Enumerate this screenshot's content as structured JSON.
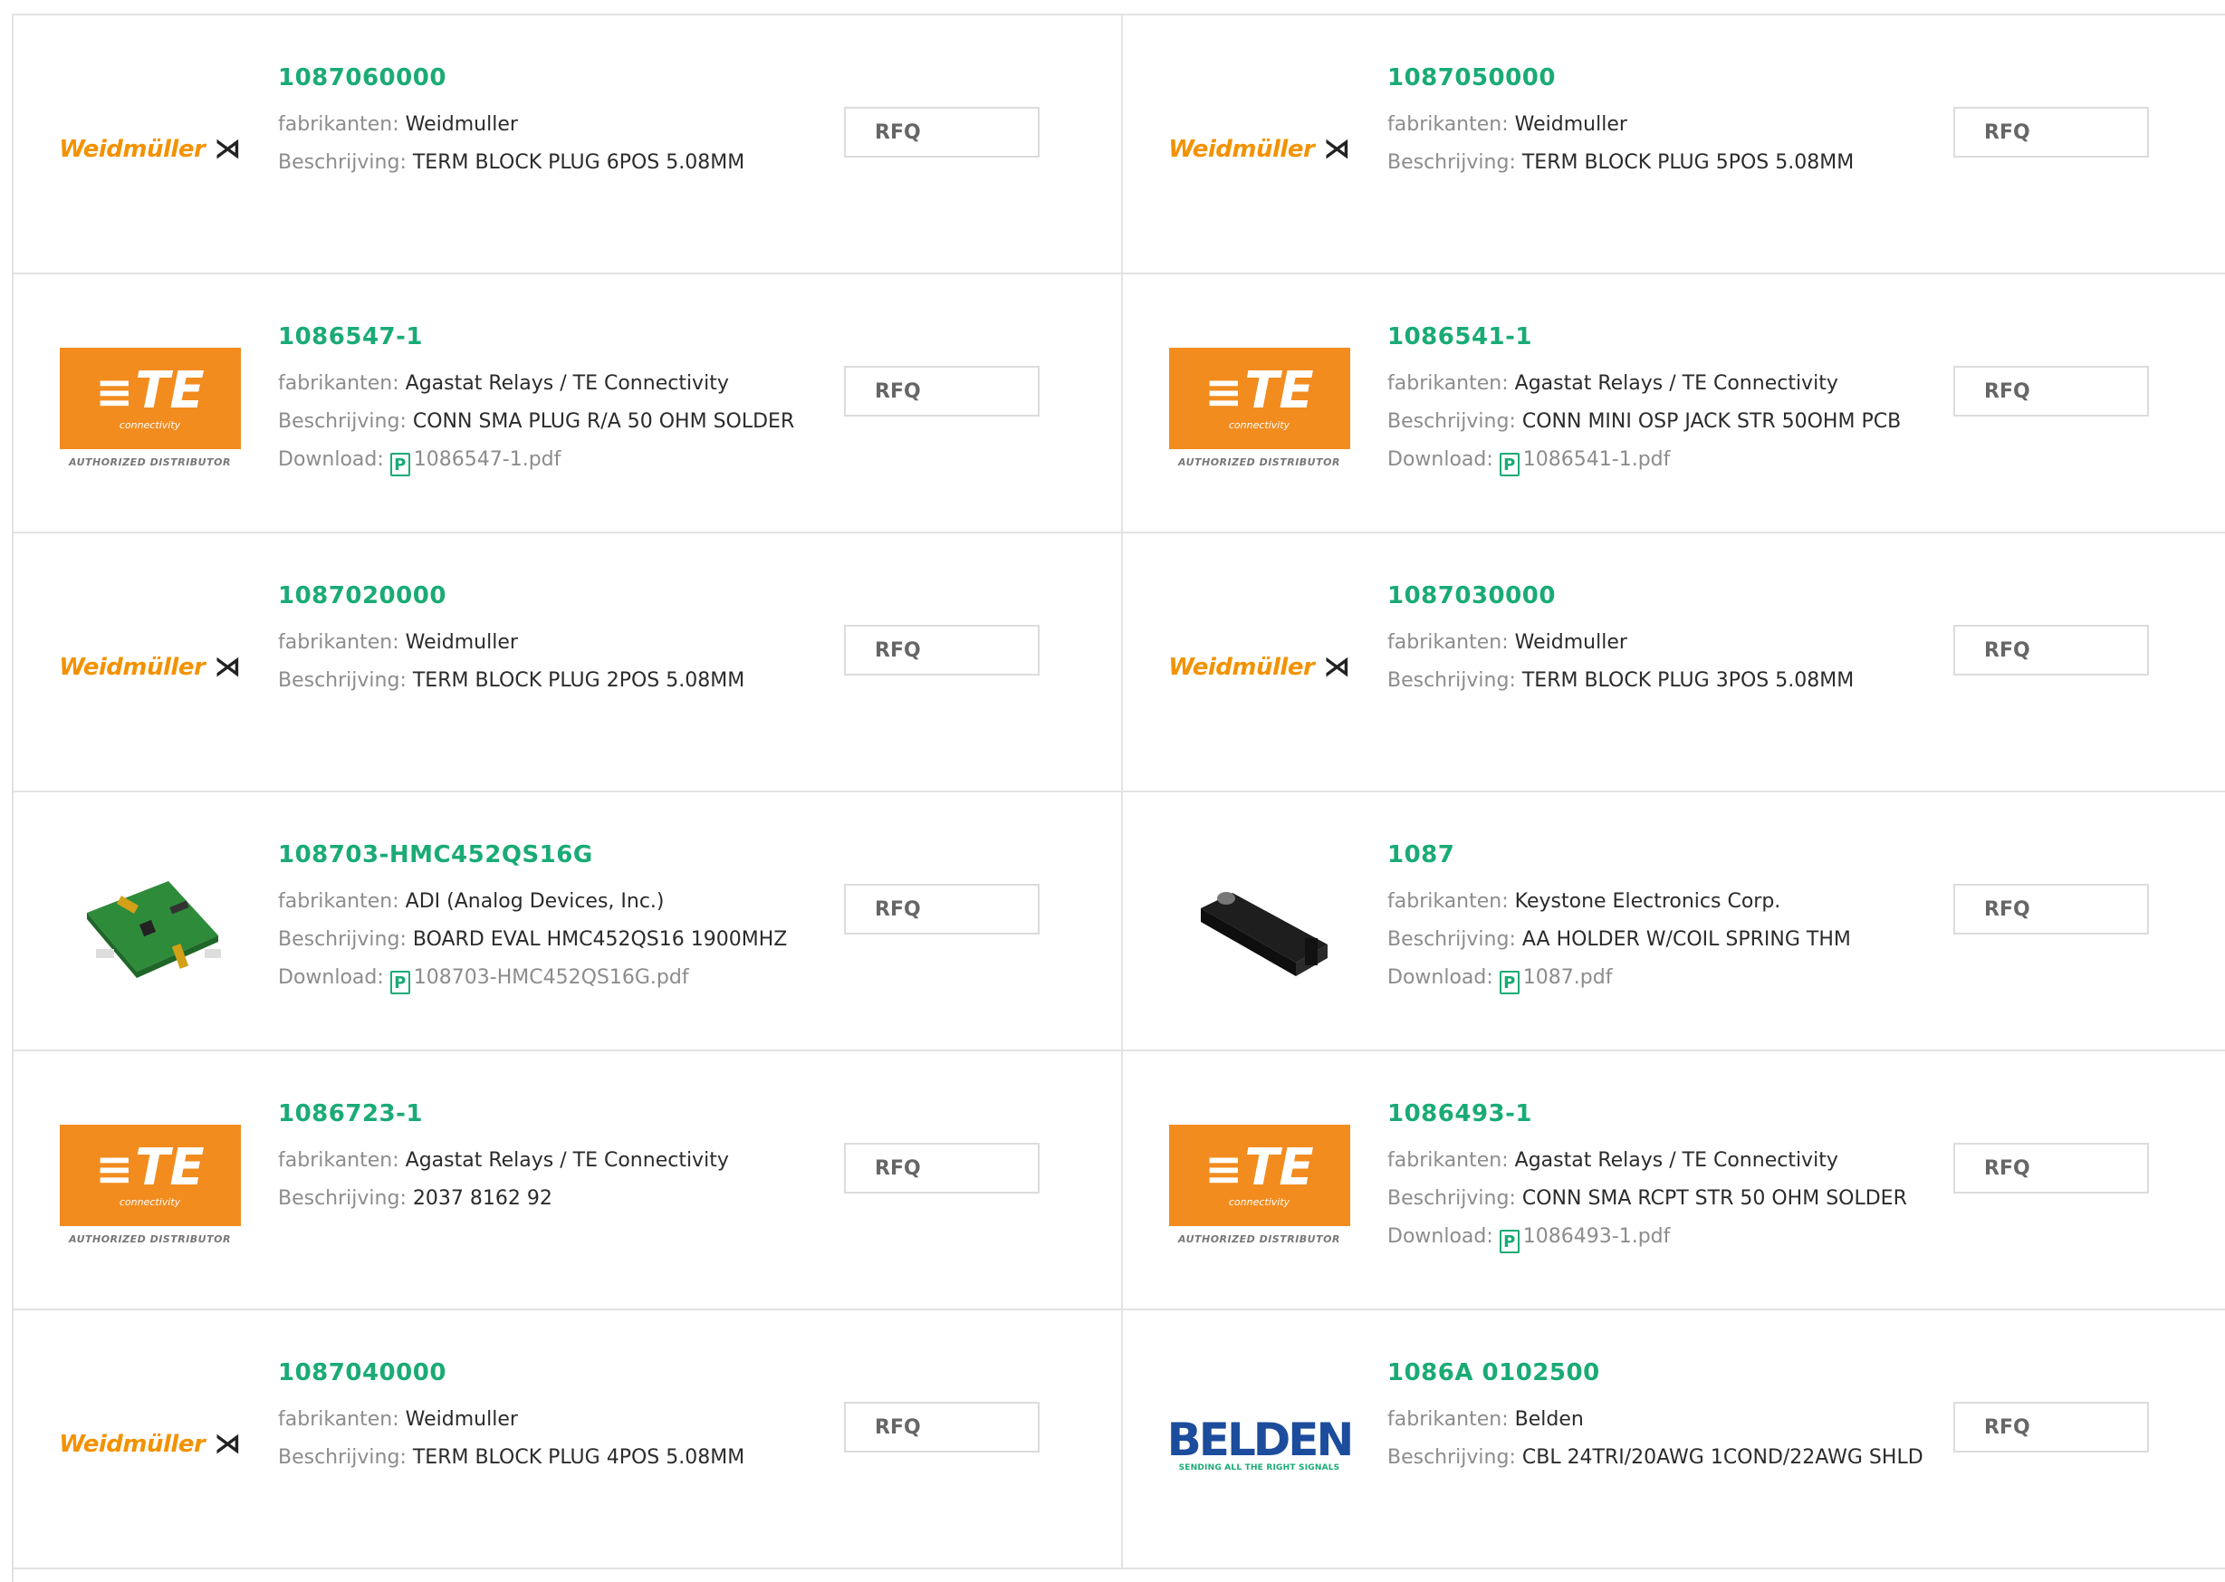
{
  "labels": {
    "manufacturer": "fabrikanten:",
    "description": "Beschrijving:",
    "download": "Download:",
    "rfq": "RFQ"
  },
  "colors": {
    "accent": "#1aab75",
    "weidmuller": "#f39200",
    "te_orange": "#f28c1f",
    "belden_blue": "#1c4c9c"
  },
  "logos": {
    "weidmuller": {
      "text": "Weidmüller",
      "icon": "weidmuller-mark-icon"
    },
    "te": {
      "text": "TE",
      "sub": "connectivity",
      "auth": "AUTHORIZED DISTRIBUTOR"
    },
    "belden": {
      "text": "BELDEN",
      "sub": "SENDING ALL THE RIGHT SIGNALS"
    }
  },
  "products": [
    {
      "pn": "1087060000",
      "manufacturer": "Weidmuller",
      "description": "TERM BLOCK PLUG 6POS 5.08MM",
      "pdf": null,
      "logo": "weidmuller"
    },
    {
      "pn": "1087050000",
      "manufacturer": "Weidmuller",
      "description": "TERM BLOCK PLUG 5POS 5.08MM",
      "pdf": null,
      "logo": "weidmuller"
    },
    {
      "pn": "1086547-1",
      "manufacturer": "Agastat Relays / TE Connectivity",
      "description": "CONN SMA PLUG R/A 50 OHM SOLDER",
      "pdf": "1086547-1.pdf",
      "logo": "te"
    },
    {
      "pn": "1086541-1",
      "manufacturer": "Agastat Relays / TE Connectivity",
      "description": "CONN MINI OSP JACK STR 50OHM PCB",
      "pdf": "1086541-1.pdf",
      "logo": "te"
    },
    {
      "pn": "1087020000",
      "manufacturer": "Weidmuller",
      "description": "TERM BLOCK PLUG 2POS 5.08MM",
      "pdf": null,
      "logo": "weidmuller"
    },
    {
      "pn": "1087030000",
      "manufacturer": "Weidmuller",
      "description": "TERM BLOCK PLUG 3POS 5.08MM",
      "pdf": null,
      "logo": "weidmuller"
    },
    {
      "pn": "108703-HMC452QS16G",
      "manufacturer": "ADI (Analog Devices, Inc.)",
      "description": "BOARD EVAL HMC452QS16 1900MHZ",
      "pdf": "108703-HMC452QS16G.pdf",
      "logo": "eval-board"
    },
    {
      "pn": "1087",
      "manufacturer": "Keystone Electronics Corp.",
      "description": "AA HOLDER W/COIL SPRING THM",
      "pdf": "1087.pdf",
      "logo": "battery-holder"
    },
    {
      "pn": "1086723-1",
      "manufacturer": "Agastat Relays / TE Connectivity",
      "description": "2037 8162 92",
      "pdf": null,
      "logo": "te"
    },
    {
      "pn": "1086493-1",
      "manufacturer": "Agastat Relays / TE Connectivity",
      "description": "CONN SMA RCPT STR 50 OHM SOLDER",
      "pdf": "1086493-1.pdf",
      "logo": "te"
    },
    {
      "pn": "1087040000",
      "manufacturer": "Weidmuller",
      "description": "TERM BLOCK PLUG 4POS 5.08MM",
      "pdf": null,
      "logo": "weidmuller"
    },
    {
      "pn": "1086A 0102500",
      "manufacturer": "Belden",
      "description": "CBL 24TRI/20AWG 1COND/22AWG SHLD",
      "pdf": null,
      "logo": "belden"
    }
  ]
}
